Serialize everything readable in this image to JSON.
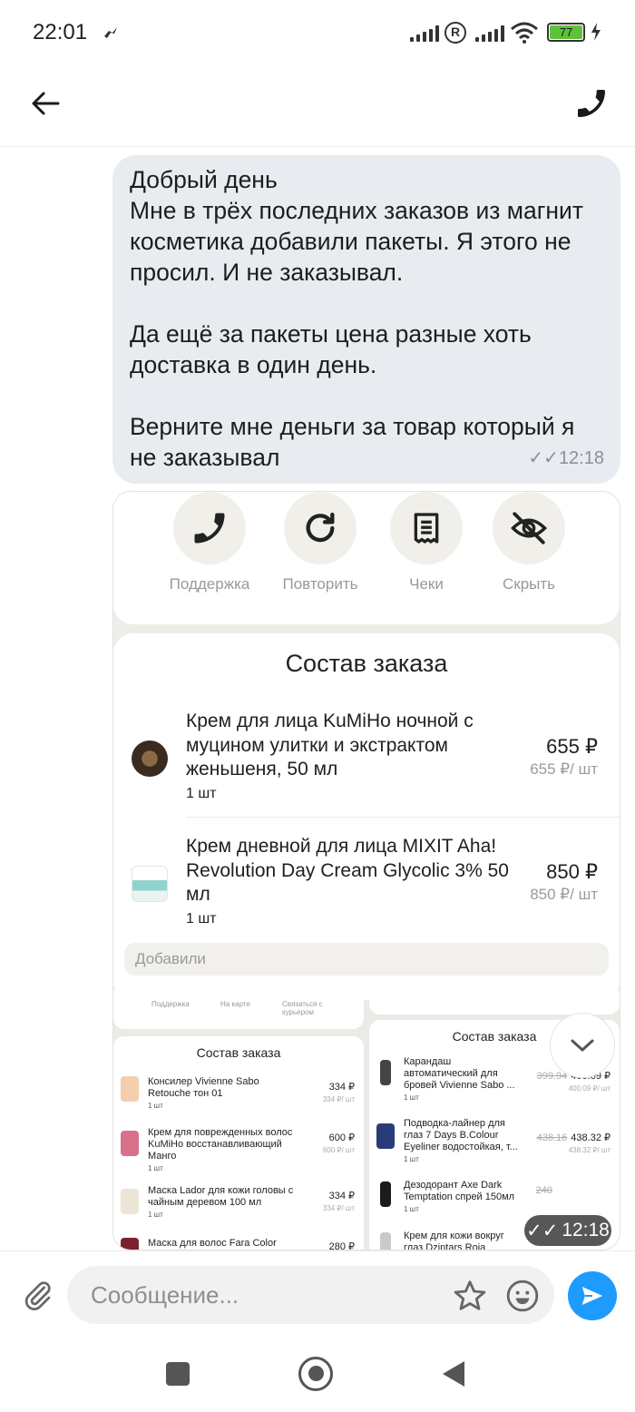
{
  "status_bar": {
    "time": "22:01",
    "battery": "77"
  },
  "message": {
    "text": "Добрый день\nМне в трёх последних заказов из магнит косметика добавили пакеты. Я этого не просил. И не заказывал.\n\nДа ещё за пакеты цена разные хоть доставка в один день.\n\nВерните мне деньги за товар который я не заказывал",
    "time": "12:18"
  },
  "attachment": {
    "actions": [
      {
        "label": "Поддержка",
        "icon": "phone-icon"
      },
      {
        "label": "Повторить",
        "icon": "refresh-icon"
      },
      {
        "label": "Чеки",
        "icon": "receipt-icon"
      },
      {
        "label": "Скрыть",
        "icon": "eye-off-icon"
      }
    ],
    "order": {
      "title": "Состав заказа",
      "items": [
        {
          "name": "Крем для лица KuMiHo ночной с муцином улитки и экстрактом женьшеня, 50 мл",
          "qty": "1 шт",
          "price": "655 ₽",
          "unit_price": "655 ₽/ шт"
        },
        {
          "name": "Крем дневной для лица MIXIT Aha! Revolution Day Cream Glycolic 3% 50 мл",
          "qty": "1 шт",
          "price": "850 ₽",
          "unit_price": "850 ₽/ шт"
        }
      ],
      "added_label": "Добавили"
    },
    "lower_left": {
      "top_labels": [
        "Поддержка",
        "На карте",
        "Связаться с курьером"
      ],
      "title": "Состав заказа",
      "items": [
        {
          "name": "Консилер Vivienne Sabo Retouche тон 01",
          "qty": "1 шт",
          "price": "334 ₽",
          "unit": "334 ₽/ шт"
        },
        {
          "name": "Крем для поврежденных волос KuMiHo восстанавливающий Манго",
          "qty": "1 шт",
          "price": "600 ₽",
          "unit": "600 ₽/ шт"
        },
        {
          "name": "Маска Lador для кожи головы с чайным деревом 100 мл",
          "qty": "1 шт",
          "price": "334 ₽",
          "unit": "334 ₽/ шт"
        },
        {
          "name": "Маска для волос Fara Color Fresh",
          "qty": "",
          "price": "280 ₽",
          "unit": ""
        }
      ]
    },
    "lower_right": {
      "title": "Состав заказа",
      "items": [
        {
          "name": "Карандаш автоматический для бровей Vivienne Sabo ...",
          "qty": "1 шт",
          "old_price": "399.94",
          "price": "400.09 ₽",
          "unit": "400.09 ₽/ шт"
        },
        {
          "name": "Подводка-лайнер для глаз 7 Days B.Colour Eyeliner водостойкая, т...",
          "qty": "1 шт",
          "old_price": "438.16",
          "price": "438.32 ₽",
          "unit": "438.32 ₽/ шт"
        },
        {
          "name": "Дезодорант Axe Dark Temptation спрей 150мл",
          "qty": "1 шт",
          "old_price": "240",
          "price": "",
          "unit": ""
        },
        {
          "name": "Крем для кожи вокруг глаз Dzintars Roja",
          "qty": "",
          "old_price": "",
          "price": "",
          "unit": ""
        }
      ]
    },
    "time": "12:18"
  },
  "composer": {
    "placeholder": "Сообщение..."
  },
  "colors": {
    "bubble": "#e8ebef",
    "send": "#1e9bff",
    "battery": "#5ec13a"
  }
}
